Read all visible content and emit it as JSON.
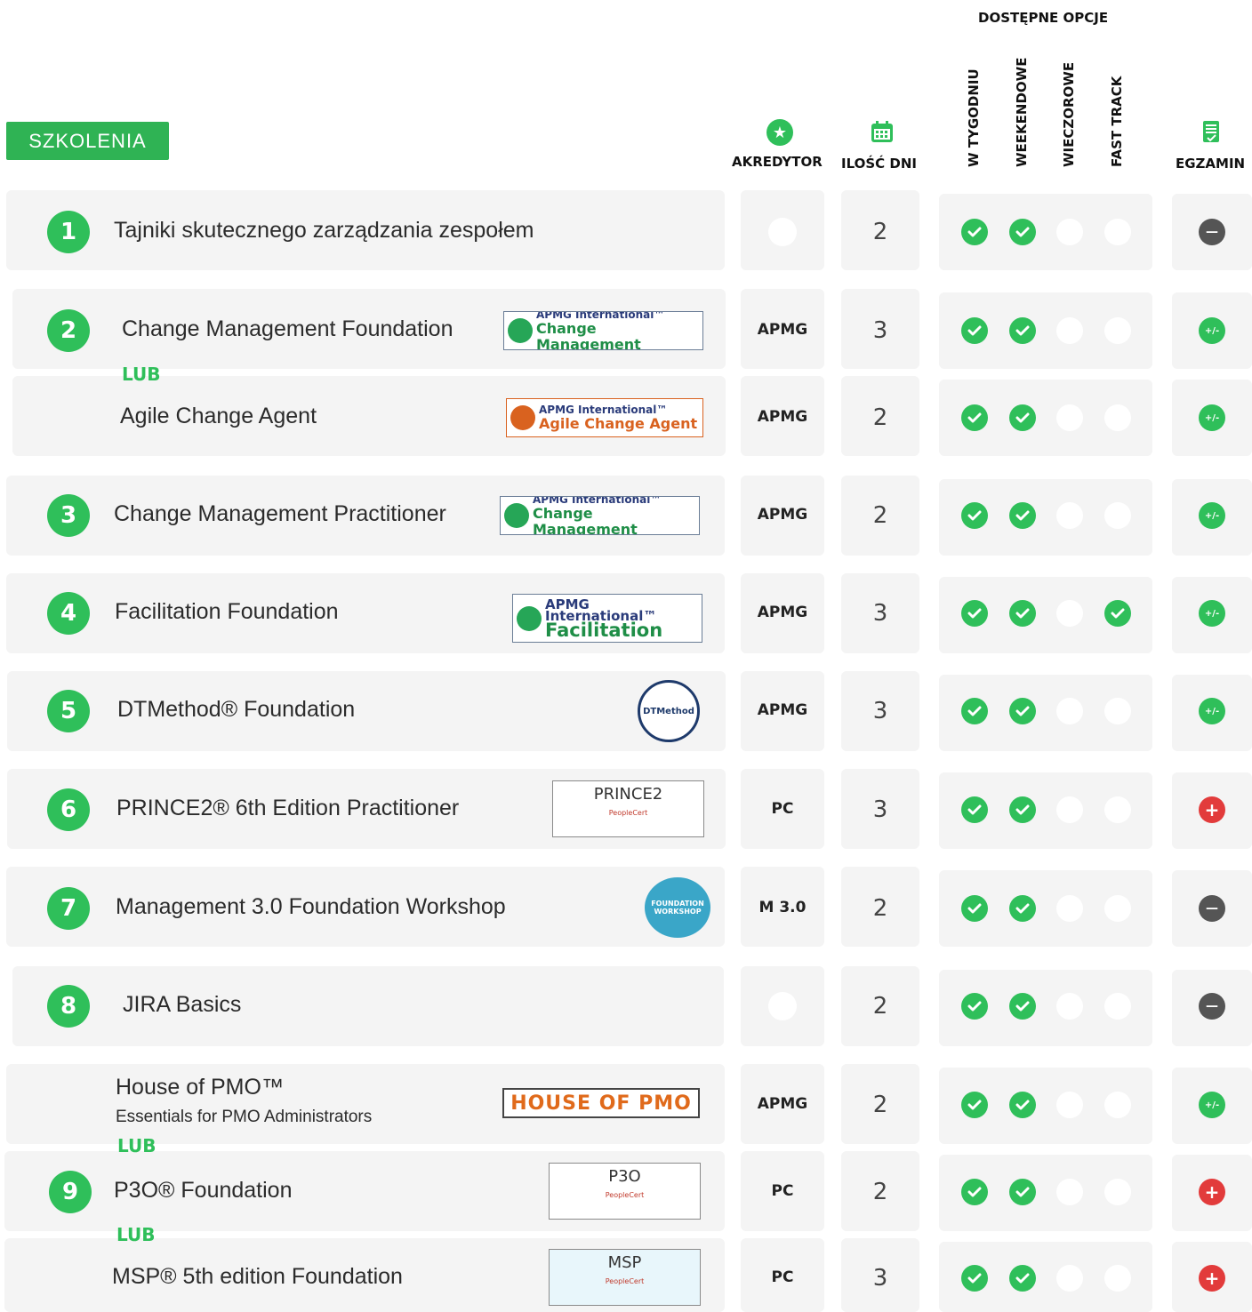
{
  "header": {
    "section_label": "SZKOLENIA",
    "options_title": "DOSTĘPNE OPCJE",
    "col_accr": "AKREDYTOR",
    "col_days": "ILOŚĆ DNI",
    "col_week": "W TYGODNIU",
    "col_weekend": "WEEKENDOWE",
    "col_evening": "WIECZOROWE",
    "col_fast": "FAST TRACK",
    "col_exam": "EGZAMIN"
  },
  "or_label": "LUB",
  "rows": [
    {
      "num": "1",
      "name": "Tajniki skutecznego zarządzania zespołem",
      "accr": "",
      "days": "2",
      "week": true,
      "weekend": true,
      "evening": false,
      "fast": false,
      "exam": "minus"
    },
    {
      "num": "2",
      "name": "Change Management Foundation",
      "accr": "APMG",
      "days": "3",
      "week": true,
      "weekend": true,
      "evening": false,
      "fast": false,
      "exam": "plusminus",
      "logo": {
        "top": "APMG International™",
        "main": "Change Management"
      }
    },
    {
      "num": "",
      "name": "Agile Change Agent",
      "accr": "APMG",
      "days": "2",
      "week": true,
      "weekend": true,
      "evening": false,
      "fast": false,
      "exam": "plusminus",
      "logo": {
        "top": "APMG International™",
        "main": "Agile Change Agent"
      }
    },
    {
      "num": "3",
      "name": "Change Management Practitioner",
      "accr": "APMG",
      "days": "2",
      "week": true,
      "weekend": true,
      "evening": false,
      "fast": false,
      "exam": "plusminus",
      "logo": {
        "top": "APMG International™",
        "main": "Change Management"
      }
    },
    {
      "num": "4",
      "name": "Facilitation Foundation",
      "accr": "APMG",
      "days": "3",
      "week": true,
      "weekend": true,
      "evening": false,
      "fast": true,
      "exam": "plusminus",
      "logo": {
        "top": "APMG International™",
        "main": "Facilitation"
      }
    },
    {
      "num": "5",
      "name": "DTMethod® Foundation",
      "accr": "APMG",
      "days": "3",
      "week": true,
      "weekend": true,
      "evening": false,
      "fast": false,
      "exam": "plusminus",
      "logo": {
        "main": "DTMethod"
      }
    },
    {
      "num": "6",
      "name": "PRINCE2® 6th Edition Practitioner",
      "accr": "PC",
      "days": "3",
      "week": true,
      "weekend": true,
      "evening": false,
      "fast": false,
      "exam": "plus",
      "logo": {
        "main": "PRINCE2"
      }
    },
    {
      "num": "7",
      "name": "Management 3.0 Foundation Workshop",
      "accr": "M 3.0",
      "days": "2",
      "week": true,
      "weekend": true,
      "evening": false,
      "fast": false,
      "exam": "minus",
      "logo": {
        "main": "FOUNDATION WORKSHOP"
      }
    },
    {
      "num": "8",
      "name": "JIRA Basics",
      "accr": "",
      "days": "2",
      "week": true,
      "weekend": true,
      "evening": false,
      "fast": false,
      "exam": "minus"
    },
    {
      "num": "",
      "name": "House of PMO™",
      "sub": "Essentials for PMO Administrators",
      "accr": "APMG",
      "days": "2",
      "week": true,
      "weekend": true,
      "evening": false,
      "fast": false,
      "exam": "plusminus",
      "logo": {
        "main": "HOUSE OF PMO"
      }
    },
    {
      "num": "9",
      "name": "P3O® Foundation",
      "accr": "PC",
      "days": "2",
      "week": true,
      "weekend": true,
      "evening": false,
      "fast": false,
      "exam": "plus",
      "logo": {
        "main": "P3O"
      }
    },
    {
      "num": "",
      "name": "MSP® 5th edition Foundation",
      "accr": "PC",
      "days": "3",
      "week": true,
      "weekend": true,
      "evening": false,
      "fast": false,
      "exam": "plus",
      "logo": {
        "main": "MSP"
      }
    }
  ],
  "peoplecert_tag": "PeopleCert",
  "colors": {
    "green": "#2fbf5a",
    "panel": "#f4f4f4",
    "gray": "#555555",
    "red": "#e23b3b"
  }
}
